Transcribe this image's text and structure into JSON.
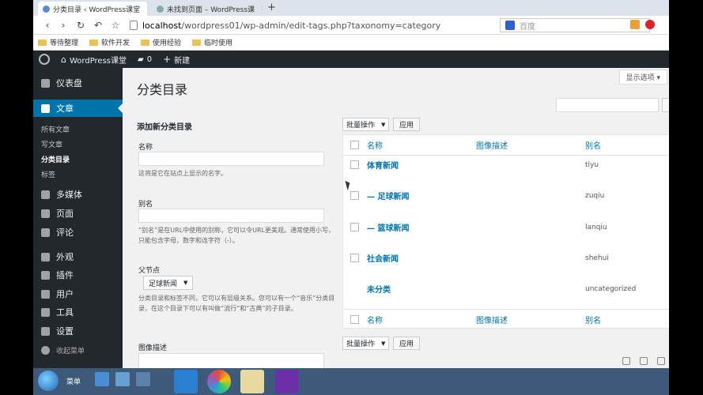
{
  "browser": {
    "tabs": [
      {
        "title": "分类目录 ‹ WordPress课堂"
      },
      {
        "title": "未找到页面 – WordPress课"
      }
    ],
    "new_tab": "+",
    "url_host": "localhost",
    "url_path": "/wordpress01/wp-admin/edit-tags.php?taxonomy=category",
    "search_placeholder": "百度"
  },
  "bookmarks": [
    "等待整理",
    "软件开发",
    "使用经验",
    "临时使用"
  ],
  "adminbar": {
    "site_name": "WordPress课堂",
    "comments_count": "0",
    "new_label": "新建"
  },
  "sidebar": {
    "items": [
      {
        "label": "仪表盘",
        "icon": "dashboard-icon"
      },
      {
        "label": "文章",
        "icon": "pin-icon"
      },
      {
        "label": "多媒体",
        "icon": "media-icon"
      },
      {
        "label": "页面",
        "icon": "page-icon"
      },
      {
        "label": "评论",
        "icon": "comment-icon"
      },
      {
        "label": "外观",
        "icon": "brush-icon"
      },
      {
        "label": "插件",
        "icon": "plugin-icon"
      },
      {
        "label": "用户",
        "icon": "user-icon"
      },
      {
        "label": "工具",
        "icon": "wrench-icon"
      },
      {
        "label": "设置",
        "icon": "settings-icon"
      },
      {
        "label": "收起菜单",
        "icon": "collapse-icon"
      }
    ],
    "subitems": [
      "所有文章",
      "写文章",
      "分类目录",
      "标签"
    ]
  },
  "page": {
    "title": "分类目录",
    "screen_options": "显示选项 ▾"
  },
  "form": {
    "title": "添加新分类目录",
    "name_label": "名称",
    "name_help": "这将是它在站点上显示的名字。",
    "slug_label": "别名",
    "slug_help": "“别名”是在URL中使用的别称，它可以令URL更美观。通常使用小写，只能包含字母，数字和连字符（-）。",
    "parent_label": "父节点",
    "parent_value": "足球新闻",
    "parent_help": "分类目录和标签不同，它可以有层级关系。您可以有一个“音乐”分类目录，在这个目录下可以有叫做“流行”和“古典”的子目录。",
    "desc_label": "图像描述"
  },
  "table": {
    "bulk_label": "批量操作",
    "apply_label": "应用",
    "columns": {
      "name": "名称",
      "description": "图像描述",
      "slug": "别名"
    },
    "rows": [
      {
        "name": "体育新闻",
        "slug": "tiyu",
        "has_checkbox": true
      },
      {
        "name": "— 足球新闻",
        "slug": "zuqiu",
        "has_checkbox": true
      },
      {
        "name": "— 篮球新闻",
        "slug": "lanqiu",
        "has_checkbox": true
      },
      {
        "name": "社会新闻",
        "slug": "shehui",
        "has_checkbox": true
      },
      {
        "name": "未分类",
        "slug": "uncategorized",
        "has_checkbox": false
      }
    ]
  },
  "taskbar": {
    "menu_label": "菜单"
  },
  "colors": {
    "admin_dark": "#23282d",
    "accent": "#0073aa",
    "background": "#f1f1f1"
  }
}
